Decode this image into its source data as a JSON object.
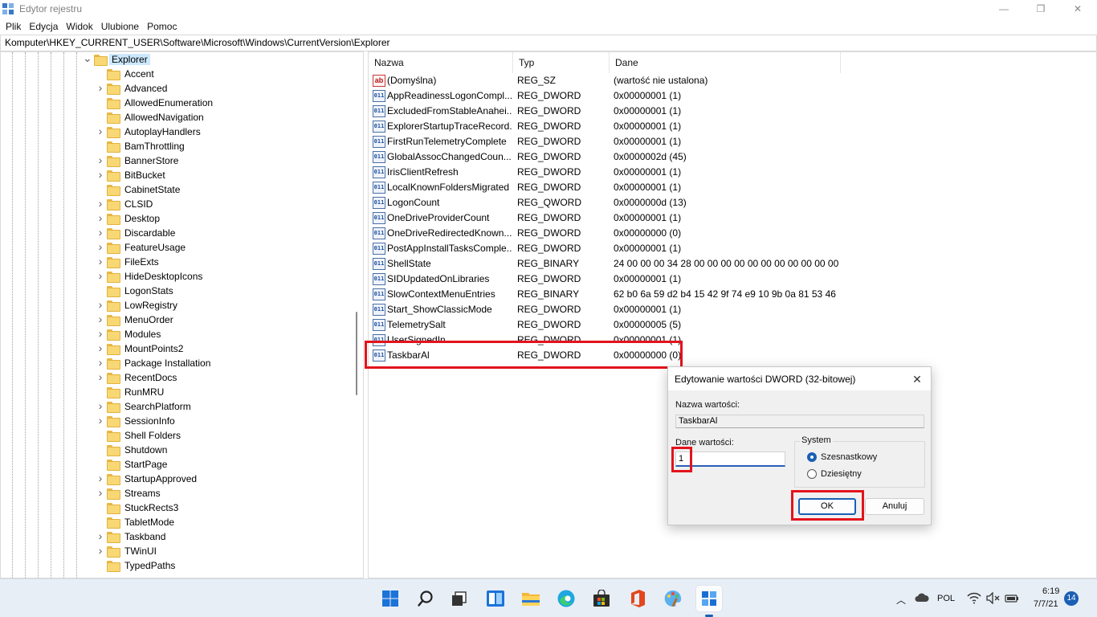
{
  "window": {
    "title": "Edytor rejestru",
    "minimize": "—",
    "restore": "❐",
    "close": "✕"
  },
  "menu": [
    "Plik",
    "Edycja",
    "Widok",
    "Ulubione",
    "Pomoc"
  ],
  "address": "Komputer\\HKEY_CURRENT_USER\\Software\\Microsoft\\Windows\\CurrentVersion\\Explorer",
  "tree": {
    "parent": "Explorer",
    "children": [
      {
        "label": "Accent",
        "expandable": false
      },
      {
        "label": "Advanced",
        "expandable": true
      },
      {
        "label": "AllowedEnumeration",
        "expandable": false
      },
      {
        "label": "AllowedNavigation",
        "expandable": false
      },
      {
        "label": "AutoplayHandlers",
        "expandable": true
      },
      {
        "label": "BamThrottling",
        "expandable": false
      },
      {
        "label": "BannerStore",
        "expandable": true
      },
      {
        "label": "BitBucket",
        "expandable": true
      },
      {
        "label": "CabinetState",
        "expandable": false
      },
      {
        "label": "CLSID",
        "expandable": true
      },
      {
        "label": "Desktop",
        "expandable": true
      },
      {
        "label": "Discardable",
        "expandable": true
      },
      {
        "label": "FeatureUsage",
        "expandable": true
      },
      {
        "label": "FileExts",
        "expandable": true
      },
      {
        "label": "HideDesktopIcons",
        "expandable": true
      },
      {
        "label": "LogonStats",
        "expandable": false
      },
      {
        "label": "LowRegistry",
        "expandable": true
      },
      {
        "label": "MenuOrder",
        "expandable": true
      },
      {
        "label": "Modules",
        "expandable": true
      },
      {
        "label": "MountPoints2",
        "expandable": true
      },
      {
        "label": "Package Installation",
        "expandable": true
      },
      {
        "label": "RecentDocs",
        "expandable": true
      },
      {
        "label": "RunMRU",
        "expandable": false
      },
      {
        "label": "SearchPlatform",
        "expandable": true
      },
      {
        "label": "SessionInfo",
        "expandable": true
      },
      {
        "label": "Shell Folders",
        "expandable": false
      },
      {
        "label": "Shutdown",
        "expandable": false
      },
      {
        "label": "StartPage",
        "expandable": false
      },
      {
        "label": "StartupApproved",
        "expandable": true
      },
      {
        "label": "Streams",
        "expandable": true
      },
      {
        "label": "StuckRects3",
        "expandable": false
      },
      {
        "label": "TabletMode",
        "expandable": false
      },
      {
        "label": "Taskband",
        "expandable": true
      },
      {
        "label": "TWinUI",
        "expandable": true
      },
      {
        "label": "TypedPaths",
        "expandable": false
      }
    ]
  },
  "columns": {
    "name": "Nazwa",
    "type": "Typ",
    "data": "Dane"
  },
  "values": [
    {
      "name": "(Domyślna)",
      "type": "REG_SZ",
      "data": "(wartość nie ustalona)",
      "icon": "ab"
    },
    {
      "name": "AppReadinessLogonCompl...",
      "type": "REG_DWORD",
      "data": "0x00000001 (1)",
      "icon": "bin"
    },
    {
      "name": "ExcludedFromStableAnahei...",
      "type": "REG_DWORD",
      "data": "0x00000001 (1)",
      "icon": "bin"
    },
    {
      "name": "ExplorerStartupTraceRecord...",
      "type": "REG_DWORD",
      "data": "0x00000001 (1)",
      "icon": "bin"
    },
    {
      "name": "FirstRunTelemetryComplete",
      "type": "REG_DWORD",
      "data": "0x00000001 (1)",
      "icon": "bin"
    },
    {
      "name": "GlobalAssocChangedCoun...",
      "type": "REG_DWORD",
      "data": "0x0000002d (45)",
      "icon": "bin"
    },
    {
      "name": "IrisClientRefresh",
      "type": "REG_DWORD",
      "data": "0x00000001 (1)",
      "icon": "bin"
    },
    {
      "name": "LocalKnownFoldersMigrated",
      "type": "REG_DWORD",
      "data": "0x00000001 (1)",
      "icon": "bin"
    },
    {
      "name": "LogonCount",
      "type": "REG_QWORD",
      "data": "0x0000000d (13)",
      "icon": "bin"
    },
    {
      "name": "OneDriveProviderCount",
      "type": "REG_DWORD",
      "data": "0x00000001 (1)",
      "icon": "bin"
    },
    {
      "name": "OneDriveRedirectedKnown...",
      "type": "REG_DWORD",
      "data": "0x00000000 (0)",
      "icon": "bin"
    },
    {
      "name": "PostAppInstallTasksComple...",
      "type": "REG_DWORD",
      "data": "0x00000001 (1)",
      "icon": "bin"
    },
    {
      "name": "ShellState",
      "type": "REG_BINARY",
      "data": "24 00 00 00 34 28 00 00 00 00 00 00 00 00 00 00 00 00...",
      "icon": "bin"
    },
    {
      "name": "SIDUpdatedOnLibraries",
      "type": "REG_DWORD",
      "data": "0x00000001 (1)",
      "icon": "bin"
    },
    {
      "name": "SlowContextMenuEntries",
      "type": "REG_BINARY",
      "data": "62 b0 6a 59 d2 b4 15 42 9f 74 e9 10 9b 0a 81 53 46 0...",
      "icon": "bin"
    },
    {
      "name": "Start_ShowClassicMode",
      "type": "REG_DWORD",
      "data": "0x00000001 (1)",
      "icon": "bin"
    },
    {
      "name": "TelemetrySalt",
      "type": "REG_DWORD",
      "data": "0x00000005 (5)",
      "icon": "bin"
    },
    {
      "name": "UserSignedIn",
      "type": "REG_DWORD",
      "data": "0x00000001 (1)",
      "icon": "bin"
    },
    {
      "name": "TaskbarAl",
      "type": "REG_DWORD",
      "data": "0x00000000 (0)",
      "icon": "bin"
    }
  ],
  "dialog": {
    "title": "Edytowanie wartości DWORD (32-bitowej)",
    "close": "✕",
    "name_label": "Nazwa wartości:",
    "name_value": "TaskbarAl",
    "data_label": "Dane wartości:",
    "data_value": "1",
    "base_group": "System",
    "base_hex": "Szesnastkowy",
    "base_dec": "Dziesiętny",
    "base_selected": "hex",
    "ok": "OK",
    "cancel": "Anuluj"
  },
  "taskbar": {
    "icons": [
      "windows-start-icon",
      "search-icon",
      "task-view-icon",
      "widgets-icon",
      "file-explorer-icon",
      "edge-icon",
      "store-icon",
      "office-icon",
      "paint-icon",
      "regedit-icon"
    ],
    "language": "POL",
    "time": "6:19",
    "date": "7/7/21",
    "notifications": "14"
  },
  "colors": {
    "highlight": "#e3131d",
    "accent": "#1a5fb4",
    "folder": "#f8d775"
  }
}
